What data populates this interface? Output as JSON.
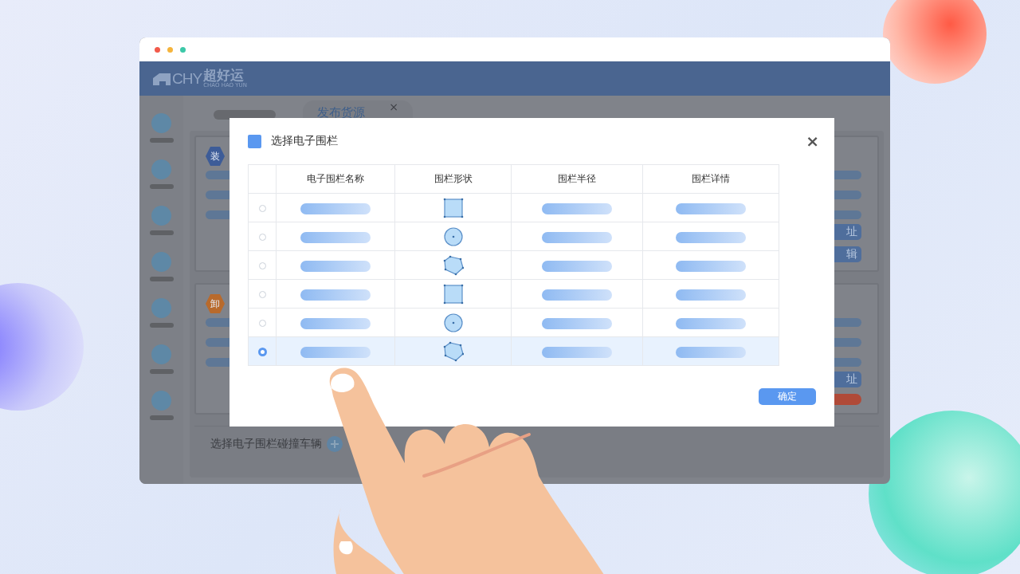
{
  "window": {
    "logo": {
      "letters": "CHY",
      "name": "超好运",
      "subtitle": "CHAO HAO YUN"
    }
  },
  "background_page": {
    "tab": {
      "label": "发布货源",
      "close": "×"
    },
    "cards": [
      {
        "badge": "装",
        "color": "#3d5c98",
        "buttons": [
          "址",
          "辑"
        ],
        "toggle": false
      },
      {
        "badge": "卸",
        "color": "#b86a2c",
        "buttons": [
          "址"
        ],
        "toggle": true
      }
    ],
    "footer_label": "选择电子围栏碰撞车辆"
  },
  "dialog": {
    "title": "选择电子围栏",
    "close": "×",
    "columns": [
      "电子围栏名称",
      "围栏形状",
      "围栏半径",
      "围栏详情"
    ],
    "rows": [
      {
        "selected": false,
        "kind": "square"
      },
      {
        "selected": false,
        "kind": "circle"
      },
      {
        "selected": false,
        "kind": "pentagon"
      },
      {
        "selected": false,
        "kind": "square"
      },
      {
        "selected": false,
        "kind": "circle"
      },
      {
        "selected": true,
        "kind": "pentagon"
      }
    ],
    "confirm": "确定"
  }
}
